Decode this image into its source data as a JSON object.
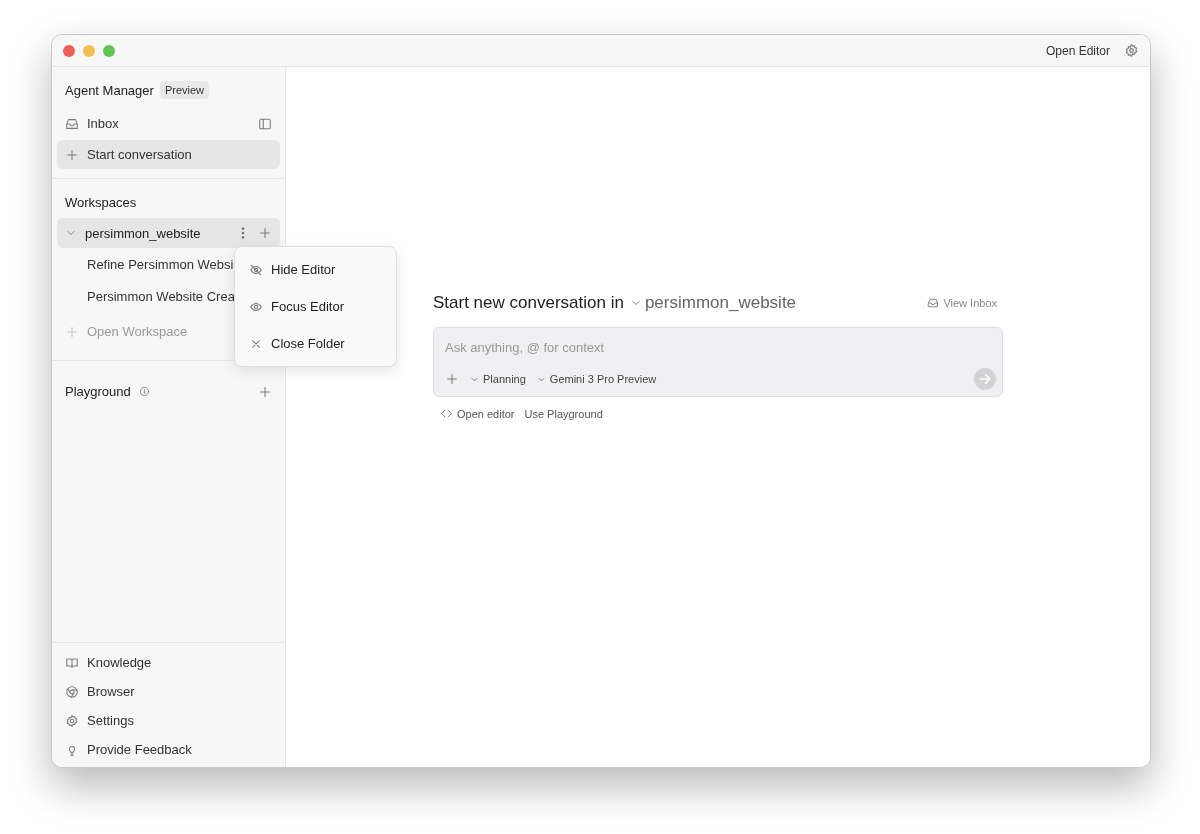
{
  "title_bar": {
    "open_editor": "Open Editor"
  },
  "sidebar": {
    "title": "Agent Manager",
    "badge": "Preview",
    "nav": [
      {
        "label": "Inbox",
        "kind": "inbox",
        "selected": false
      },
      {
        "label": "Start conversation",
        "kind": "new",
        "selected": true
      }
    ],
    "workspaces": {
      "heading": "Workspaces",
      "items": [
        {
          "name": "persimmon_website",
          "expanded": true,
          "selected": true,
          "children": [
            {
              "label": "Refine Persimmon Websi"
            },
            {
              "label": "Persimmon Website Crea"
            }
          ]
        }
      ],
      "open_workspace": {
        "label": "Open Workspace",
        "disabled": true
      }
    },
    "playground": {
      "label": "Playground"
    },
    "footer": [
      {
        "label": "Knowledge",
        "kind": "book"
      },
      {
        "label": "Browser",
        "kind": "browser"
      },
      {
        "label": "Settings",
        "kind": "gear"
      },
      {
        "label": "Provide Feedback",
        "kind": "bulb"
      }
    ]
  },
  "context_menu": [
    {
      "label": "Hide Editor",
      "kind": "eye-off"
    },
    {
      "label": "Focus Editor",
      "kind": "eye"
    },
    {
      "label": "Close Folder",
      "kind": "close"
    }
  ],
  "main": {
    "title": "Start new conversation in",
    "workspace": "persimmon_website",
    "view_inbox": "View Inbox",
    "composer": {
      "placeholder": "Ask anything, @ for context",
      "mode": "Planning",
      "model": "Gemini 3 Pro Preview"
    },
    "links": [
      {
        "label": "Open editor",
        "kind": "code"
      },
      {
        "label": "Use Playground",
        "kind": "plain"
      }
    ]
  }
}
